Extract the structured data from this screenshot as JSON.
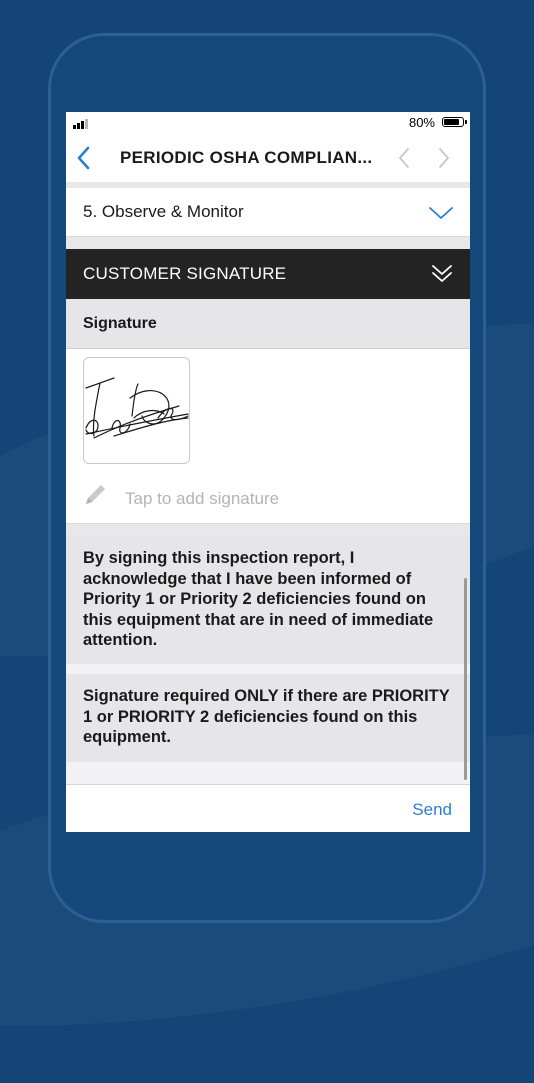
{
  "status_bar": {
    "battery_percent": "80%"
  },
  "nav": {
    "title": "PERIODIC OSHA COMPLIAN...",
    "back_icon": "chevron-left-icon",
    "prev_icon": "chevron-left-icon",
    "next_icon": "chevron-right-icon"
  },
  "sections": {
    "observe_label": "5. Observe & Monitor",
    "customer_signature_label": "CUSTOMER SIGNATURE"
  },
  "signature": {
    "label": "Signature",
    "placeholder": "Tap to add signature"
  },
  "notices": {
    "acknowledgement": "By signing this inspection report, I acknowledge that I have been informed of Priority 1 or Priority 2 deficiencies found on this equipment that are in need of immediate attention.",
    "requirement": "Signature required ONLY if there are PRIORITY 1 or PRIORITY 2 deficiencies found on this equipment."
  },
  "footer": {
    "send_label": "Send"
  },
  "colors": {
    "background": "#134576",
    "accent": "#2b7fd0",
    "header_dark": "#232323"
  }
}
